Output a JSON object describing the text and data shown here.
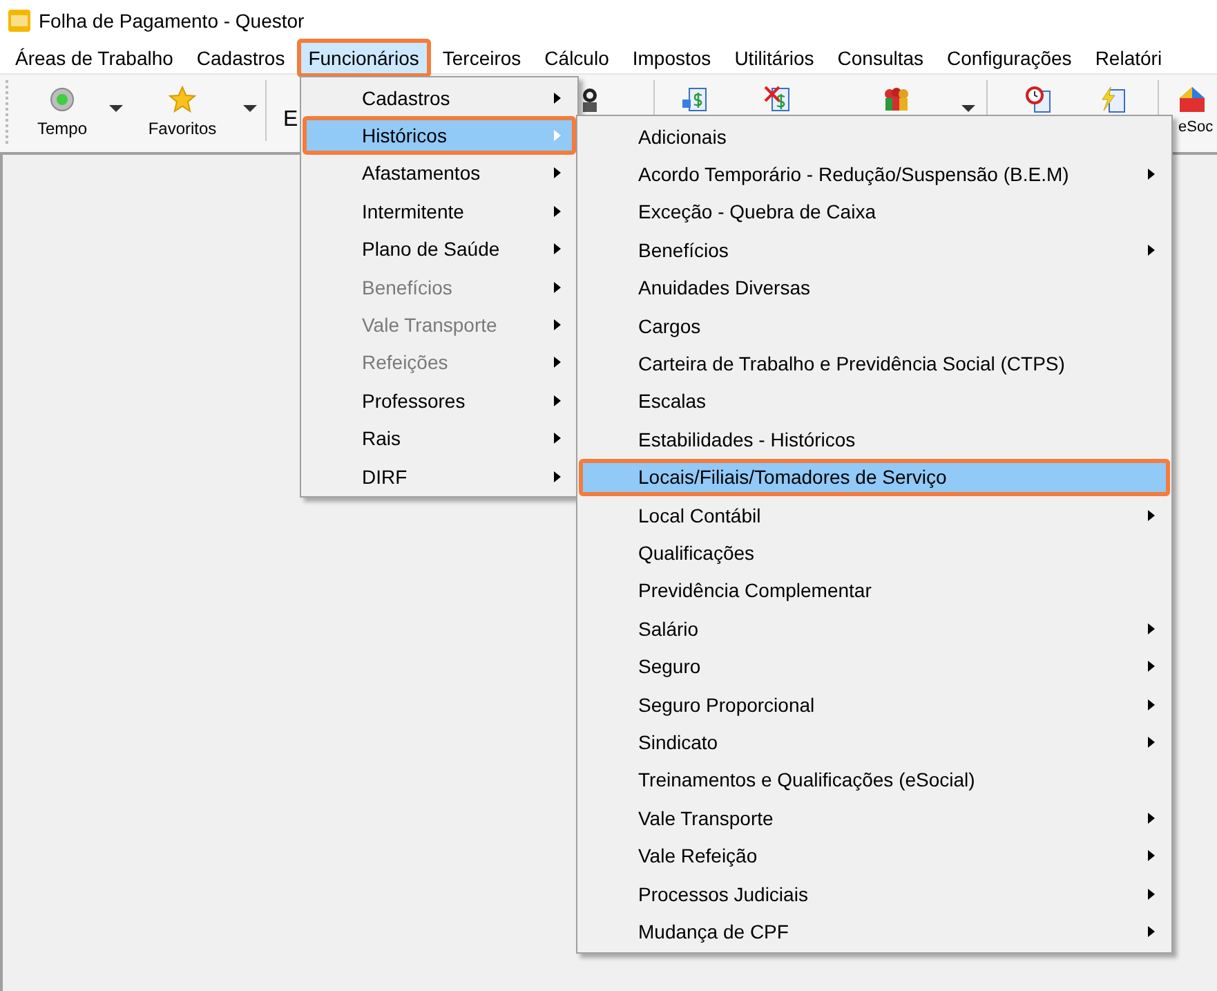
{
  "window": {
    "title": "Folha de Pagamento - Questor"
  },
  "menubar": [
    {
      "label": "Áreas de Trabalho",
      "selected": false
    },
    {
      "label": "Cadastros",
      "selected": false
    },
    {
      "label": "Funcionários",
      "selected": true
    },
    {
      "label": "Terceiros",
      "selected": false
    },
    {
      "label": "Cálculo",
      "selected": false
    },
    {
      "label": "Impostos",
      "selected": false
    },
    {
      "label": "Utilitários",
      "selected": false
    },
    {
      "label": "Consultas",
      "selected": false
    },
    {
      "label": "Configurações",
      "selected": false
    },
    {
      "label": "Relatóri",
      "selected": false
    }
  ],
  "toolbar": [
    {
      "kind": "grip"
    },
    {
      "kind": "light",
      "label": "Tempo"
    },
    {
      "kind": "caret"
    },
    {
      "kind": "star",
      "label": "Favoritos"
    },
    {
      "kind": "caret"
    },
    {
      "kind": "separator"
    },
    {
      "kind": "text",
      "label": "E"
    },
    {
      "kind": "person"
    },
    {
      "kind": "separator"
    },
    {
      "kind": "money-arrow"
    },
    {
      "kind": "money-x"
    },
    {
      "kind": "people"
    },
    {
      "kind": "caret"
    },
    {
      "kind": "separator"
    },
    {
      "kind": "money-clock"
    },
    {
      "kind": "money-bolt"
    },
    {
      "kind": "separator"
    },
    {
      "kind": "house",
      "label": "eSoc"
    }
  ],
  "menu": {
    "items": [
      {
        "label": "Cadastros",
        "selected": false,
        "disabled": false,
        "has_submenu": true
      },
      {
        "label": "Históricos",
        "selected": true,
        "disabled": false,
        "has_submenu": true
      },
      {
        "label": "Afastamentos",
        "selected": false,
        "disabled": false,
        "has_submenu": true
      },
      {
        "label": "Intermitente",
        "selected": false,
        "disabled": false,
        "has_submenu": true
      },
      {
        "label": "Plano de Saúde",
        "selected": false,
        "disabled": false,
        "has_submenu": true
      },
      {
        "label": "Benefícios",
        "selected": false,
        "disabled": true,
        "has_submenu": true
      },
      {
        "label": "Vale Transporte",
        "selected": false,
        "disabled": true,
        "has_submenu": true
      },
      {
        "label": "Refeições",
        "selected": false,
        "disabled": true,
        "has_submenu": true
      },
      {
        "label": "Professores",
        "selected": false,
        "disabled": false,
        "has_submenu": true
      },
      {
        "label": "Rais",
        "selected": false,
        "disabled": false,
        "has_submenu": true
      },
      {
        "label": "DIRF",
        "selected": false,
        "disabled": false,
        "has_submenu": true
      }
    ]
  },
  "submenu": {
    "items": [
      {
        "label": "Adicionais",
        "selected": false,
        "has_submenu": false
      },
      {
        "label": "Acordo Temporário - Redução/Suspensão (B.E.M)",
        "selected": false,
        "has_submenu": true
      },
      {
        "label": "Exceção - Quebra de Caixa",
        "selected": false,
        "has_submenu": false
      },
      {
        "label": "Benefícios",
        "selected": false,
        "has_submenu": true
      },
      {
        "label": "Anuidades Diversas",
        "selected": false,
        "has_submenu": false
      },
      {
        "label": "Cargos",
        "selected": false,
        "has_submenu": false
      },
      {
        "label": "Carteira de Trabalho e Previdência Social (CTPS)",
        "selected": false,
        "has_submenu": false
      },
      {
        "label": "Escalas",
        "selected": false,
        "has_submenu": false
      },
      {
        "label": "Estabilidades - Históricos",
        "selected": false,
        "has_submenu": false
      },
      {
        "label": "Locais/Filiais/Tomadores de Serviço",
        "selected": true,
        "has_submenu": false
      },
      {
        "label": "Local Contábil",
        "selected": false,
        "has_submenu": true
      },
      {
        "label": "Qualificações",
        "selected": false,
        "has_submenu": false
      },
      {
        "label": "Previdência Complementar",
        "selected": false,
        "has_submenu": false
      },
      {
        "label": "Salário",
        "selected": false,
        "has_submenu": true
      },
      {
        "label": "Seguro",
        "selected": false,
        "has_submenu": true
      },
      {
        "label": "Seguro Proporcional",
        "selected": false,
        "has_submenu": true
      },
      {
        "label": "Sindicato",
        "selected": false,
        "has_submenu": true
      },
      {
        "label": "Treinamentos e Qualificações (eSocial)",
        "selected": false,
        "has_submenu": false
      },
      {
        "label": "Vale Transporte",
        "selected": false,
        "has_submenu": true
      },
      {
        "label": "Vale Refeição",
        "selected": false,
        "has_submenu": true
      },
      {
        "label": "Processos Judiciais",
        "selected": false,
        "has_submenu": true
      },
      {
        "label": "Mudança de CPF",
        "selected": false,
        "has_submenu": true
      }
    ]
  }
}
